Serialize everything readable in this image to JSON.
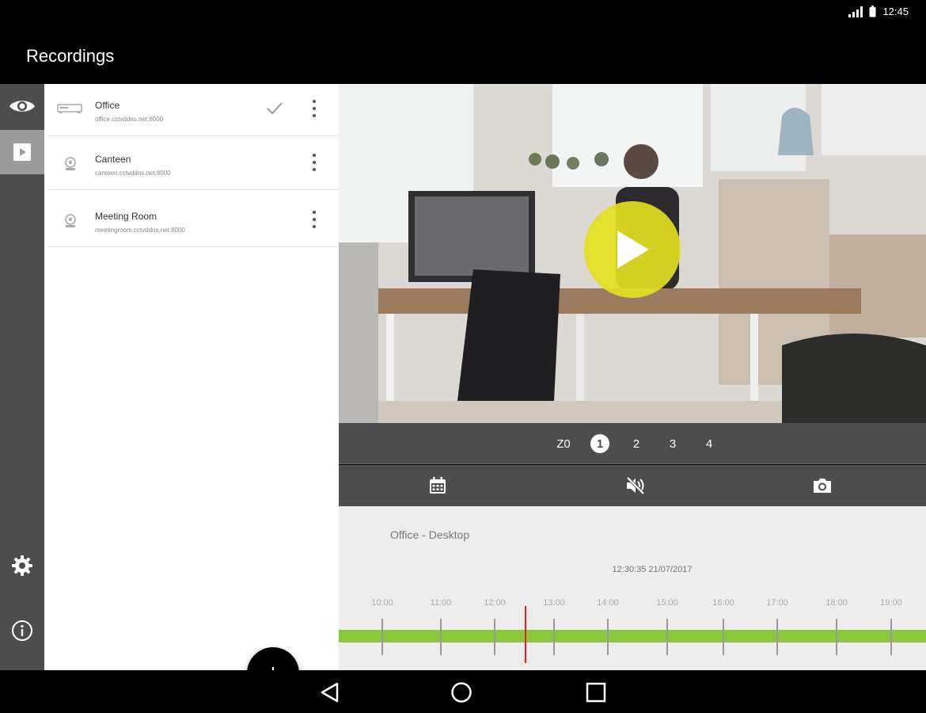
{
  "status": {
    "time": "12:45"
  },
  "app": {
    "title": "Recordings"
  },
  "cameras": [
    {
      "name": "Office",
      "url": "office.cctvddns.net:8000",
      "selected": true,
      "icon": "dvr-icon"
    },
    {
      "name": "Canteen",
      "url": "canteen.cctvddns.net:8000",
      "selected": false,
      "icon": "webcam-icon"
    },
    {
      "name": "Meeting Room",
      "url": "meetingroom.cctvddns.net:8000",
      "selected": false,
      "icon": "webcam-icon"
    }
  ],
  "fab": {
    "label": "+"
  },
  "pages": {
    "items": [
      "Z0",
      "1",
      "2",
      "3",
      "4"
    ],
    "active": "1"
  },
  "timeline": {
    "camera": "Office - Desktop",
    "current": "12:30:35   21/07/2017",
    "hours": [
      "10:00",
      "11:00",
      "12:00",
      "13:00",
      "14:00",
      "15:00",
      "16:00",
      "17:00",
      "18:00",
      "19:00"
    ]
  },
  "colors": {
    "accent": "#E2E01E",
    "recording": "#8CC63F",
    "cursor": "#E0241B",
    "rail": "#4D4D4D"
  }
}
